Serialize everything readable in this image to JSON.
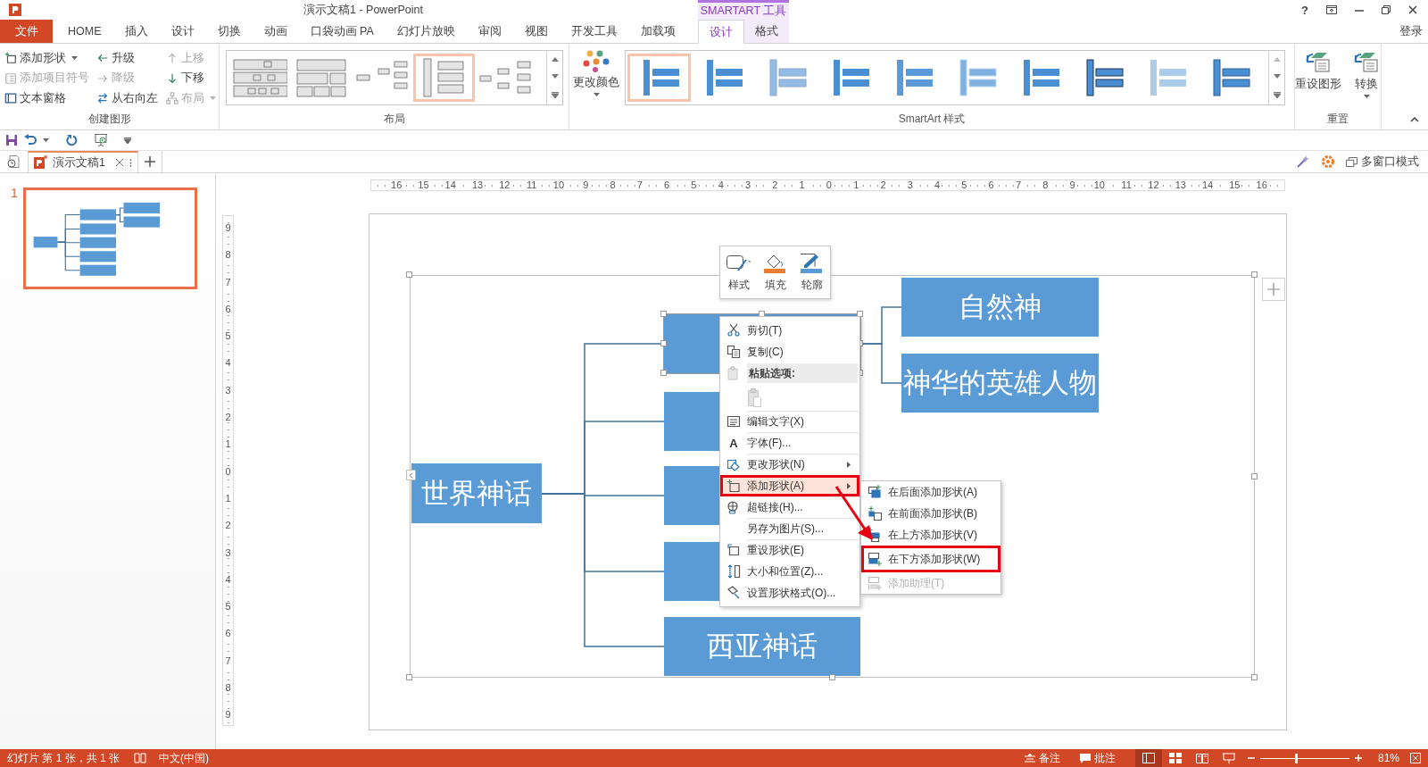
{
  "title_bar": {
    "title": "演示文稿1 - PowerPoint",
    "contextual_group": "SMARTART 工具",
    "help": "?"
  },
  "ribbon_tabs": [
    {
      "label": "文件",
      "kind": "file",
      "selected": false
    },
    {
      "label": "HOME",
      "kind": "tab",
      "selected": false
    },
    {
      "label": "插入",
      "kind": "tab",
      "selected": false
    },
    {
      "label": "设计",
      "kind": "tab",
      "selected": false
    },
    {
      "label": "切换",
      "kind": "tab",
      "selected": false
    },
    {
      "label": "动画",
      "kind": "tab",
      "selected": false
    },
    {
      "label": "口袋动画 PA",
      "kind": "tab",
      "selected": false
    },
    {
      "label": "幻灯片放映",
      "kind": "tab",
      "selected": false
    },
    {
      "label": "审阅",
      "kind": "tab",
      "selected": false
    },
    {
      "label": "视图",
      "kind": "tab",
      "selected": false
    },
    {
      "label": "开发工具",
      "kind": "tab",
      "selected": false
    },
    {
      "label": "加载项",
      "kind": "tab",
      "selected": false
    },
    {
      "label": "设计",
      "kind": "contextual",
      "selected": true
    },
    {
      "label": "格式",
      "kind": "contextual",
      "selected": false
    }
  ],
  "sign_in": "登录",
  "ribbon": {
    "create_graphic": {
      "label": "创建图形",
      "commands": [
        {
          "label": "添加形状",
          "disabled": false,
          "dropdown": true
        },
        {
          "label": "升级",
          "disabled": false,
          "dropdown": false
        },
        {
          "label": "上移",
          "disabled": true,
          "dropdown": false
        },
        {
          "label": "添加项目符号",
          "disabled": true,
          "dropdown": false
        },
        {
          "label": "降级",
          "disabled": true,
          "dropdown": false
        },
        {
          "label": "下移",
          "disabled": false,
          "dropdown": false
        },
        {
          "label": "文本窗格",
          "disabled": false,
          "dropdown": false
        },
        {
          "label": "从右向左",
          "disabled": false,
          "dropdown": false
        },
        {
          "label": "布局",
          "disabled": true,
          "dropdown": true
        }
      ]
    },
    "layouts": {
      "label": "布局",
      "items": [
        {
          "selected": false
        },
        {
          "selected": false
        },
        {
          "selected": false
        },
        {
          "selected": true
        },
        {
          "selected": false
        }
      ]
    },
    "smartart_styles": {
      "label": "SmartArt 样式",
      "change_colors": "更改颜色",
      "items": [
        {
          "selected": true
        },
        {
          "selected": false
        },
        {
          "selected": false
        },
        {
          "selected": false
        },
        {
          "selected": false
        },
        {
          "selected": false
        },
        {
          "selected": false
        },
        {
          "selected": false
        },
        {
          "selected": false
        },
        {
          "selected": false
        }
      ]
    },
    "reset": {
      "label": "重置",
      "commands": [
        {
          "label": "重设图形",
          "dropdown": false
        },
        {
          "label": "转换",
          "dropdown": true
        }
      ]
    }
  },
  "document_tabs": {
    "tabs": [
      {
        "label": "演示文稿1",
        "selected": true
      }
    ],
    "multi_window": "多窗口模式"
  },
  "slides_pane": {
    "slides": [
      {
        "number": "1",
        "selected": true
      }
    ]
  },
  "rulers": {
    "horizontal": [
      "16",
      "15",
      "14",
      "13",
      "12",
      "11",
      "10",
      "9",
      "8",
      "7",
      "6",
      "5",
      "4",
      "3",
      "2",
      "1",
      "0",
      "1",
      "2",
      "3",
      "4",
      "5",
      "6",
      "7",
      "8",
      "9",
      "10",
      "11",
      "12",
      "13",
      "14",
      "15",
      "16"
    ],
    "vertical": [
      "9",
      "8",
      "7",
      "6",
      "5",
      "4",
      "3",
      "2",
      "1",
      "0",
      "1",
      "2",
      "3",
      "4",
      "5",
      "6",
      "7",
      "8",
      "9"
    ]
  },
  "slide": {
    "diagram": {
      "root": {
        "label": "世界神话"
      },
      "branches": [
        {
          "selected": true,
          "children": [
            {
              "label": "自然神"
            },
            {
              "label": "神华的英雄人物"
            }
          ]
        },
        {
          "selected": false
        },
        {
          "selected": false
        },
        {
          "selected": false
        },
        {
          "selected": false,
          "label": "西亚神话"
        }
      ]
    }
  },
  "mini_toolbar": {
    "buttons": [
      {
        "label": "样式"
      },
      {
        "label": "填充"
      },
      {
        "label": "轮廓"
      }
    ]
  },
  "context_menu": {
    "items": [
      {
        "kind": "item",
        "label": "剪切(T)",
        "divider": false,
        "submenu": false,
        "highlighted": false
      },
      {
        "kind": "item",
        "label": "复制(C)",
        "divider": false,
        "submenu": false,
        "highlighted": false
      },
      {
        "kind": "header",
        "label": "粘贴选项:"
      },
      {
        "kind": "paste_options"
      },
      {
        "kind": "item",
        "label": "编辑文字(X)",
        "divider": true,
        "submenu": false,
        "highlighted": false
      },
      {
        "kind": "item",
        "label": "字体(F)...",
        "icon_text": "A",
        "divider": true,
        "submenu": false,
        "highlighted": false
      },
      {
        "kind": "item",
        "label": "更改形状(N)",
        "divider": true,
        "submenu": true,
        "highlighted": false
      },
      {
        "kind": "item",
        "label": "添加形状(A)",
        "divider": false,
        "submenu": true,
        "highlighted": true,
        "annotated": true
      },
      {
        "kind": "item",
        "label": "超链接(H)...",
        "divider": true,
        "submenu": false,
        "highlighted": false
      },
      {
        "kind": "item",
        "label": "另存为图片(S)...",
        "divider": true,
        "submenu": false,
        "highlighted": false
      },
      {
        "kind": "item",
        "label": "重设形状(E)",
        "divider": true,
        "submenu": false,
        "highlighted": false
      },
      {
        "kind": "item",
        "label": "大小和位置(Z)...",
        "divider": false,
        "submenu": false,
        "highlighted": false
      },
      {
        "kind": "item",
        "label": "设置形状格式(O)...",
        "divider": false,
        "submenu": false,
        "highlighted": false
      }
    ],
    "submenu": {
      "items": [
        {
          "label": "在后面添加形状(A)",
          "disabled": false
        },
        {
          "label": "在前面添加形状(B)",
          "disabled": false
        },
        {
          "label": "在上方添加形状(V)",
          "disabled": false
        },
        {
          "label": "在下方添加形状(W)",
          "disabled": false,
          "annotated": true
        },
        {
          "label": "添加助理(T)",
          "disabled": true
        }
      ]
    }
  },
  "status_bar": {
    "slide_info": "幻灯片 第 1 张，共 1 张",
    "language": "中文(中国)",
    "notes": "备注",
    "comments": "批注",
    "views": [
      {
        "selected": true
      },
      {
        "selected": false
      },
      {
        "selected": false
      },
      {
        "selected": false
      }
    ],
    "zoom": {
      "level": 0.4,
      "reading": "81%"
    }
  }
}
